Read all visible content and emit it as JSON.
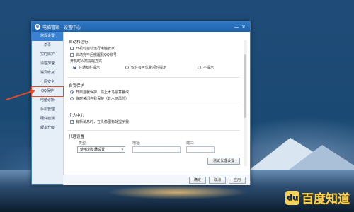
{
  "window": {
    "title": "电脑管家 - 设置中心",
    "minimize": "—",
    "close": "×"
  },
  "sidebar": {
    "items": [
      {
        "label": "常规设置",
        "active": true
      },
      {
        "label": "杀毒"
      },
      {
        "label": "实时防护"
      },
      {
        "label": "清理加速"
      },
      {
        "label": "漏洞修复"
      },
      {
        "label": "上网安全"
      },
      {
        "label": "QQ保护",
        "highlight": true
      },
      {
        "label": "电脑诊所"
      },
      {
        "label": "手机管理"
      },
      {
        "label": "硬件检测"
      },
      {
        "label": "版本升级"
      }
    ]
  },
  "general": {
    "title": "启动和运行",
    "opt1": "开机时自动运行电脑管家",
    "opt2": "启动完毕后提醒我QQ账号",
    "tray_label": "开机时火箭提醒方式",
    "radio1": "在通知栏提示",
    "radio2": "仅在有可优化项时提示",
    "radio3": "不提示"
  },
  "protect": {
    "title": "自我保护",
    "radio1": "开启自我保护，防止木马恶意篡改",
    "radio2": "临时关闭自我保护（有木马风险）"
  },
  "personal": {
    "title": "个人中心",
    "opt1": "有新消息时，在头像图标处提示我"
  },
  "proxy": {
    "title": "代理设置",
    "type_label": "类型:",
    "addr_label": "地址:",
    "port_label": "端口:",
    "type_value": "使用浏览器设置",
    "test_button": "测试代理设置"
  },
  "footer": {
    "ok": "确定",
    "cancel": "取消",
    "apply": "应用"
  },
  "watermark": {
    "text": "百度知道",
    "icon": "du"
  }
}
